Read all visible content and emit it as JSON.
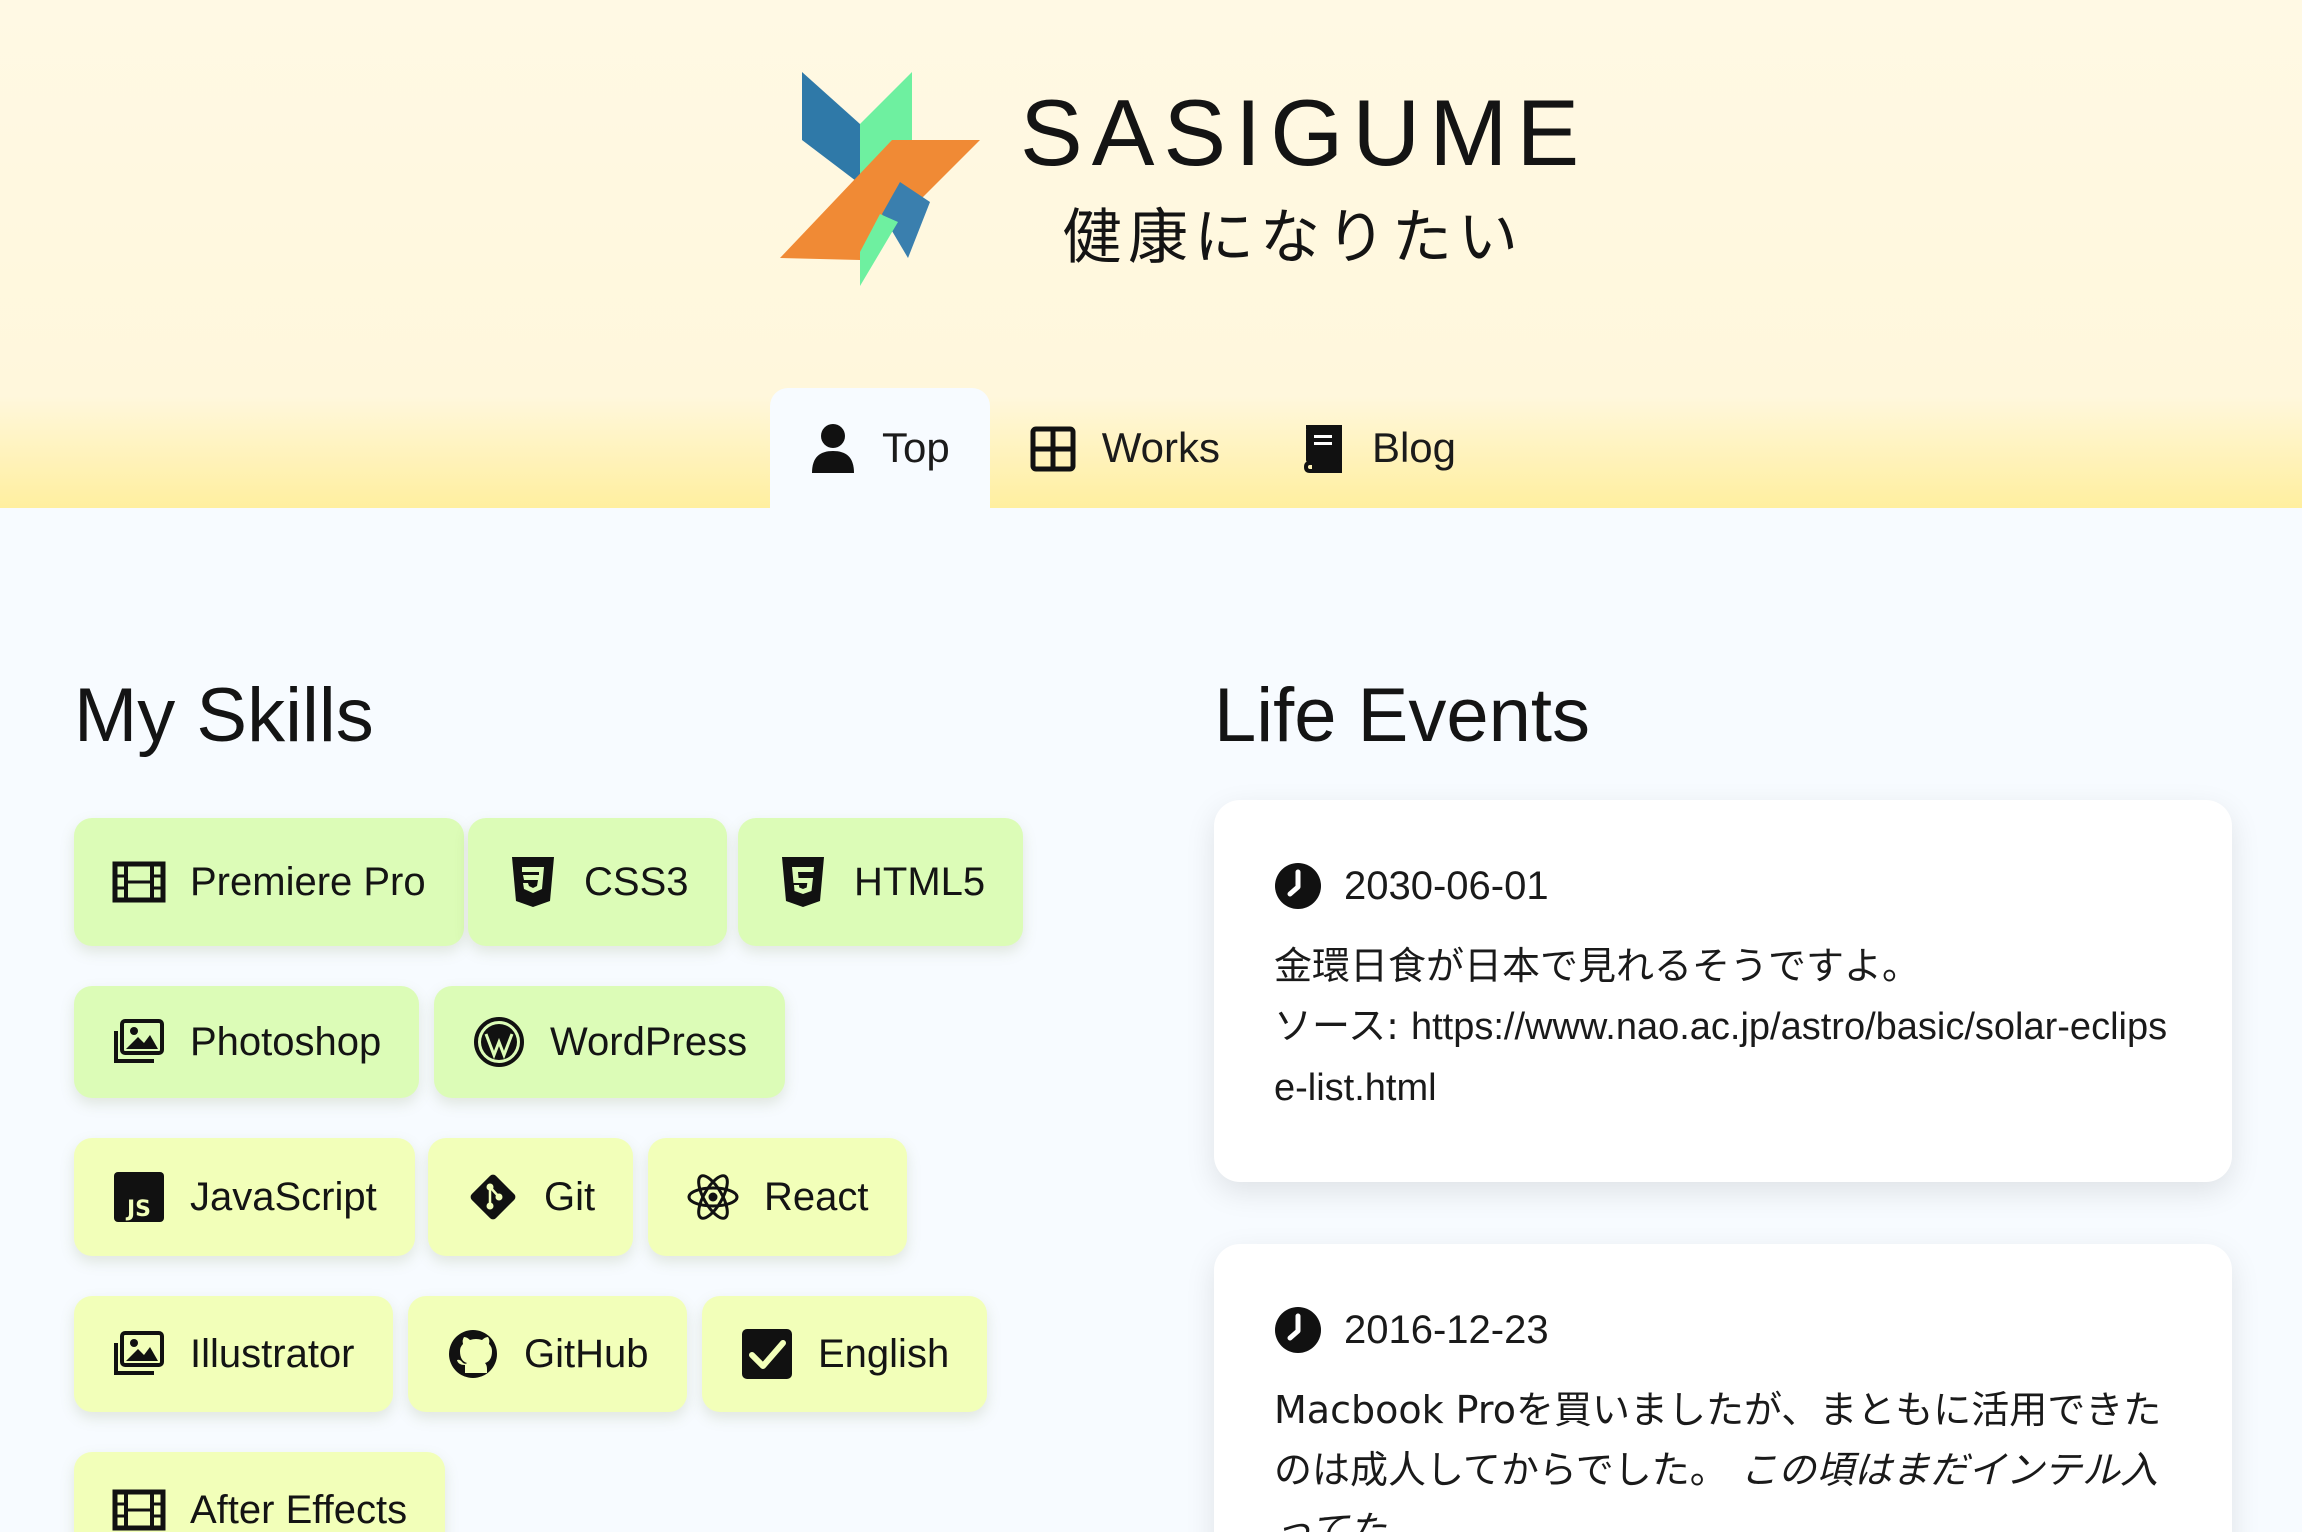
{
  "header": {
    "title": "SASIGUME",
    "tagline": "健康になりたい",
    "logo_colors": [
      "#2f79a8",
      "#6ef0a0",
      "#f08a35",
      "#3a7fae"
    ]
  },
  "nav": {
    "tabs": [
      {
        "label": "Top",
        "icon": "user-icon",
        "active": true
      },
      {
        "label": "Works",
        "icon": "grid-icon",
        "active": false
      },
      {
        "label": "Blog",
        "icon": "book-icon",
        "active": false
      }
    ]
  },
  "skills": {
    "title": "My Skills",
    "items": [
      {
        "label": "Premiere Pro",
        "icon": "film-icon"
      },
      {
        "label": "CSS3",
        "icon": "css3-icon"
      },
      {
        "label": "HTML5",
        "icon": "html5-icon"
      },
      {
        "label": "Photoshop",
        "icon": "images-icon"
      },
      {
        "label": "WordPress",
        "icon": "wordpress-icon"
      },
      {
        "label": "JavaScript",
        "icon": "javascript-icon"
      },
      {
        "label": "Git",
        "icon": "git-icon"
      },
      {
        "label": "React",
        "icon": "react-icon"
      },
      {
        "label": "Illustrator",
        "icon": "images-icon"
      },
      {
        "label": "GitHub",
        "icon": "github-icon"
      },
      {
        "label": "English",
        "icon": "checkbox-icon"
      },
      {
        "label": "After Effects",
        "icon": "film-icon"
      }
    ]
  },
  "events": {
    "title": "Life Events",
    "items": [
      {
        "date": "2030-06-01",
        "line1": "金環日食が日本で見れるそうですよ。",
        "source_prefix": "ソース: ",
        "source_url": "https://www.nao.ac.jp/astro/basic/solar-eclipse-list.html"
      },
      {
        "date": "2016-12-23",
        "text": "Macbook Proを買いましたが、まともに活用できたのは成人してからでした。",
        "note": "この頃はまだインテル入ってた"
      }
    ]
  },
  "colors": {
    "header_bg": "#fff9e4",
    "page_bg": "#f7fbff",
    "skill_green": "#dcfcb7",
    "skill_lime": "#f2ffb9"
  }
}
